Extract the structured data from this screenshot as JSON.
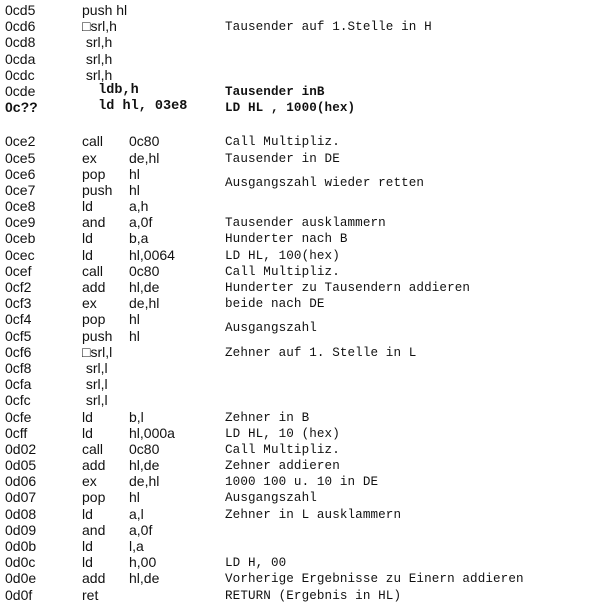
{
  "listing": [
    {
      "addr": "0cd5",
      "op": "push hl",
      "args": "",
      "comment": ""
    },
    {
      "addr": "0cd6",
      "op": "□srl,h",
      "args": "",
      "comment": "Tausender auf 1.Stelle in H"
    },
    {
      "addr": "0cd8",
      "op": " srl,h",
      "args": "",
      "comment": ""
    },
    {
      "addr": "0cda",
      "op": " srl,h",
      "args": "",
      "comment": ""
    },
    {
      "addr": "0cdc",
      "op": " srl,h",
      "args": "",
      "comment": ""
    },
    {
      "addr": "0cde",
      "op": "  ldb,h",
      "args": "",
      "comment": "Tausender inB"
    },
    {
      "addr": "0c??",
      "op": "  ld hl, 03e8",
      "args": "",
      "comment": "LD HL , 1000(hex)"
    },
    {
      "addr": "0ce2",
      "op": "call",
      "args": "0c80",
      "comment": "Call Multipliz."
    },
    {
      "addr": "0ce5",
      "op": "ex",
      "args": "de,hl",
      "comment": "Tausender in DE"
    },
    {
      "addr": "0ce6",
      "op": "pop",
      "args": "hl",
      "comment": "Ausgangszahl wieder retten"
    },
    {
      "addr": "0ce7",
      "op": "push",
      "args": "hl",
      "comment": ""
    },
    {
      "addr": "0ce8",
      "op": "ld",
      "args": "a,h",
      "comment": ""
    },
    {
      "addr": "0ce9",
      "op": "and",
      "args": "a,0f",
      "comment": "Tausender ausklammern"
    },
    {
      "addr": "0ceb",
      "op": "ld",
      "args": "b,a",
      "comment": "Hunderter nach B"
    },
    {
      "addr": "0cec",
      "op": "ld",
      "args": "hl,0064",
      "comment": "LD HL, 100(hex)"
    },
    {
      "addr": "0cef",
      "op": "call",
      "args": "0c80",
      "comment": "Call Multipliz."
    },
    {
      "addr": "0cf2",
      "op": "add",
      "args": "hl,de",
      "comment": "Hunderter zu Tausendern addieren"
    },
    {
      "addr": "0cf3",
      "op": "ex",
      "args": "de,hl",
      "comment": "beide nach DE"
    },
    {
      "addr": "0cf4",
      "op": "pop",
      "args": "hl",
      "comment": "Ausgangszahl"
    },
    {
      "addr": "0cf5",
      "op": "push",
      "args": "hl",
      "comment": ""
    },
    {
      "addr": "0cf6",
      "op": "□srl,l",
      "args": "",
      "comment": "Zehner auf 1. Stelle in L"
    },
    {
      "addr": "0cf8",
      "op": " srl,l",
      "args": "",
      "comment": ""
    },
    {
      "addr": "0cfa",
      "op": " srl,l",
      "args": "",
      "comment": ""
    },
    {
      "addr": "0cfc",
      "op": " srl,l",
      "args": "",
      "comment": ""
    },
    {
      "addr": "0cfe",
      "op": "ld",
      "args": "b,l",
      "comment": "Zehner in B"
    },
    {
      "addr": "0cff",
      "op": "ld",
      "args": "hl,000a",
      "comment": "LD HL, 10 (hex)"
    },
    {
      "addr": "0d02",
      "op": "call",
      "args": "0c80",
      "comment": "Call Multipliz."
    },
    {
      "addr": "0d05",
      "op": "add",
      "args": "hl,de",
      "comment": "Zehner addieren"
    },
    {
      "addr": "0d06",
      "op": "ex",
      "args": "de,hl",
      "comment": "1000 100 u. 10 in DE"
    },
    {
      "addr": "0d07",
      "op": "pop",
      "args": "hl",
      "comment": "Ausgangszahl"
    },
    {
      "addr": "0d08",
      "op": "ld",
      "args": "a,l",
      "comment": "Zehner in L ausklammern"
    },
    {
      "addr": "0d09",
      "op": "and",
      "args": "a,0f",
      "comment": ""
    },
    {
      "addr": "0d0b",
      "op": "ld",
      "args": "l,a",
      "comment": ""
    },
    {
      "addr": "0d0c",
      "op": "ld",
      "args": "h,00",
      "comment": "LD H, 00"
    },
    {
      "addr": "0d0e",
      "op": "add",
      "args": "hl,de",
      "comment": "Vorherige Ergebnisse zu Einern addieren"
    },
    {
      "addr": "0d0f",
      "op": "ret",
      "args": "",
      "comment": "RETURN (Ergebnis in HL)"
    }
  ]
}
